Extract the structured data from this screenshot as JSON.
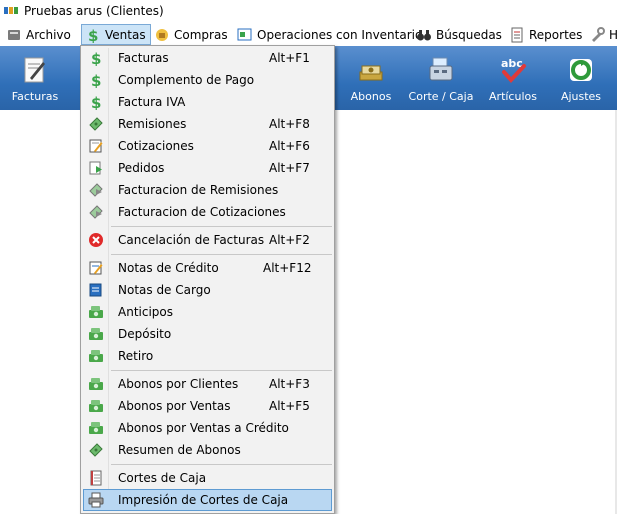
{
  "window": {
    "title": "Pruebas arus (Clientes)"
  },
  "menubar": {
    "items": [
      {
        "label": "Archivo",
        "icon": "archive-icon"
      },
      {
        "label": "Ventas",
        "icon": "dollar-icon"
      },
      {
        "label": "Compras",
        "icon": "purchases-icon"
      },
      {
        "label": "Operaciones con Inventario",
        "icon": "inventory-icon"
      },
      {
        "label": "Búsquedas",
        "icon": "binoculars-icon"
      },
      {
        "label": "Reportes",
        "icon": "report-icon"
      },
      {
        "label": "H",
        "icon": "tools-icon"
      }
    ]
  },
  "toolbar": {
    "buttons": [
      {
        "label": "Facturas",
        "icon": "invoice-pen-icon"
      },
      {
        "label": "Abonos",
        "icon": "money-stack-icon"
      },
      {
        "label": "Corte / Caja",
        "icon": "cash-register-icon"
      },
      {
        "label": "Artículos",
        "icon": "abc-check-icon"
      },
      {
        "label": "Ajustes",
        "icon": "recycle-icon"
      }
    ]
  },
  "ventas_menu": {
    "items": [
      {
        "label": "Facturas",
        "shortcut": "Alt+F1",
        "icon": "dollar-icon"
      },
      {
        "label": "Complemento de Pago",
        "shortcut": "",
        "icon": "dollar-icon"
      },
      {
        "label": "Factura IVA",
        "shortcut": "",
        "icon": "dollar-icon"
      },
      {
        "label": "Remisiones",
        "shortcut": "Alt+F8",
        "icon": "bill-icon"
      },
      {
        "label": "Cotizaciones",
        "shortcut": "Alt+F6",
        "icon": "quote-icon"
      },
      {
        "label": "Pedidos",
        "shortcut": "Alt+F7",
        "icon": "order-icon"
      },
      {
        "label": "Facturacion de Remisiones",
        "shortcut": "",
        "icon": "convert-icon"
      },
      {
        "label": "Facturacion de Cotizaciones",
        "shortcut": "",
        "icon": "convert-icon"
      },
      {
        "label": "Cancelación de Facturas",
        "shortcut": "Alt+F2",
        "icon": "cancel-icon"
      },
      {
        "label": "Notas de Crédito",
        "shortcut": "Alt+F12",
        "icon": "credit-note-icon"
      },
      {
        "label": "Notas de Cargo",
        "shortcut": "",
        "icon": "charge-note-icon"
      },
      {
        "label": "Anticipos",
        "shortcut": "",
        "icon": "money-icon"
      },
      {
        "label": "Depósito",
        "shortcut": "",
        "icon": "money-icon"
      },
      {
        "label": "Retiro",
        "shortcut": "",
        "icon": "money-icon"
      },
      {
        "label": "Abonos por Clientes",
        "shortcut": "Alt+F3",
        "icon": "money-icon"
      },
      {
        "label": "Abonos por Ventas",
        "shortcut": "Alt+F5",
        "icon": "money-icon"
      },
      {
        "label": "Abonos por Ventas a Crédito",
        "shortcut": "",
        "icon": "money-icon"
      },
      {
        "label": "Resumen de Abonos",
        "shortcut": "",
        "icon": "bill-icon"
      },
      {
        "label": "Cortes de Caja",
        "shortcut": "",
        "icon": "ledger-icon"
      },
      {
        "label": "Impresión de Cortes de Caja",
        "shortcut": "",
        "icon": "printer-icon"
      }
    ]
  },
  "colors": {
    "toolbar": "#2f6fb8",
    "menu_selected": "#b9d7f2",
    "menu_bg": "#f2f2f2"
  }
}
